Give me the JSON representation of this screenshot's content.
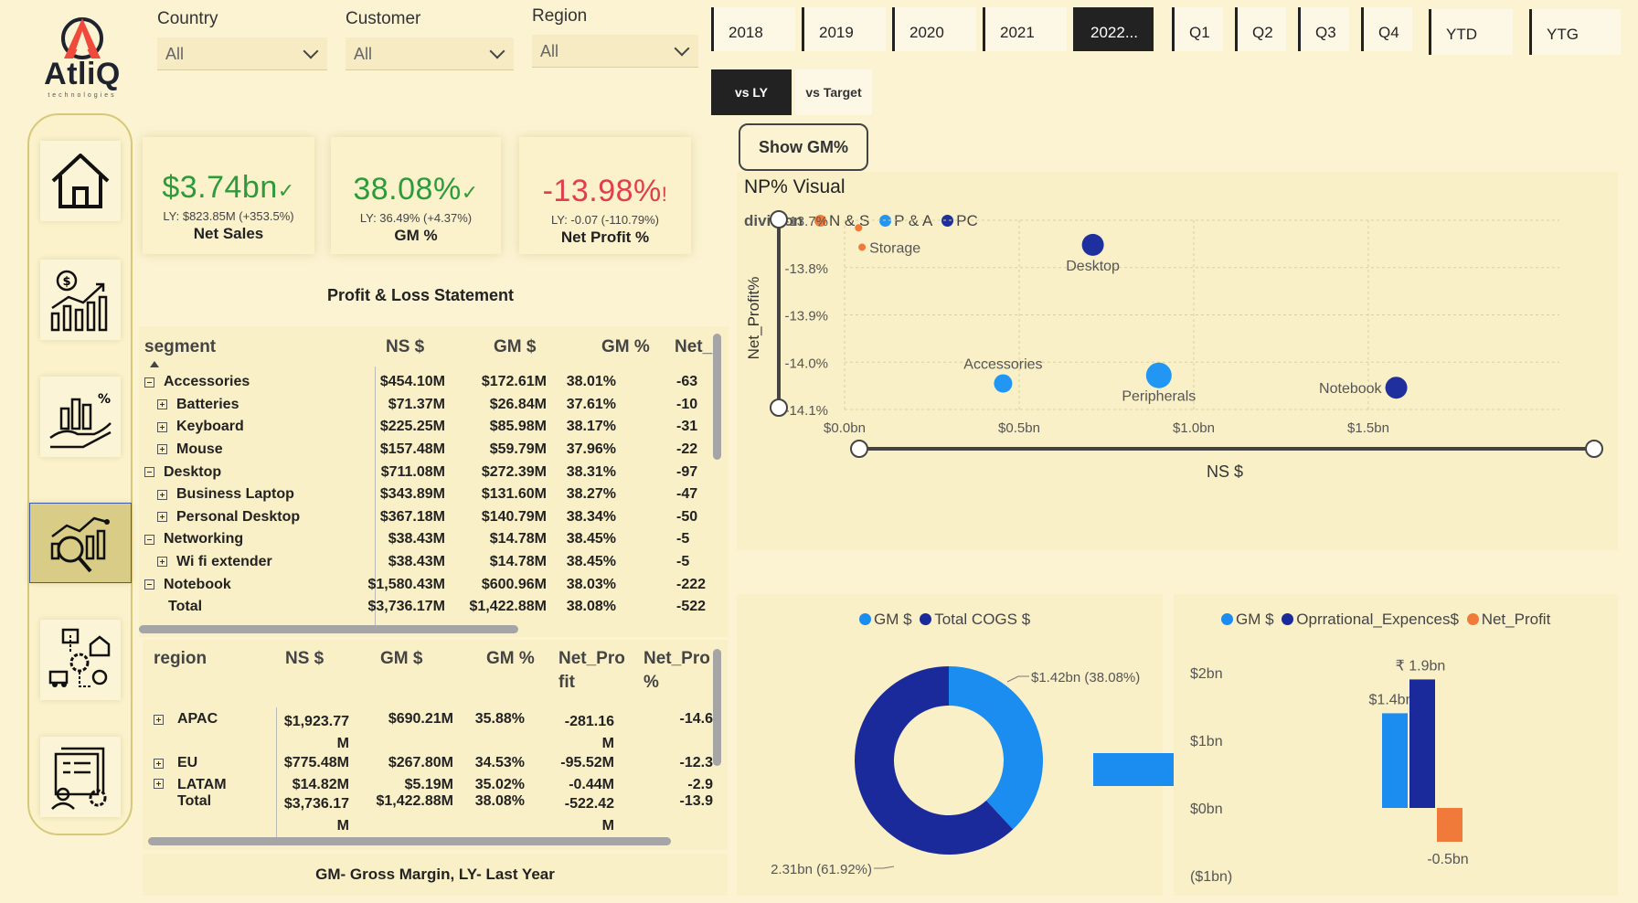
{
  "logo": {
    "name": "AtliQ",
    "sub": "technologies"
  },
  "filters": [
    {
      "label": "Country",
      "value": "All"
    },
    {
      "label": "Customer",
      "value": "All"
    },
    {
      "label": "Region",
      "value": "All"
    }
  ],
  "years": [
    "2018",
    "2019",
    "2020",
    "2021",
    "2022..."
  ],
  "selected_year": "2022...",
  "quarters": [
    "Q1",
    "Q2",
    "Q3",
    "Q4"
  ],
  "periods": [
    "YTD",
    "YTG"
  ],
  "compare": {
    "vs_ly": "vs LY",
    "vs_target": "vs Target",
    "selected": "vs LY"
  },
  "show_gm_button": "Show GM%",
  "nav": [
    "home-icon",
    "finance-chart-icon",
    "analytics-icon",
    "magnifier-chart-icon",
    "supply-chain-icon",
    "executive-report-icon"
  ],
  "kpis": [
    {
      "value": "$3.74bn",
      "mark": "✓",
      "ly": "LY: $823.85M (+353.5%)",
      "label": "Net Sales",
      "color": "#2e9a3c"
    },
    {
      "value": "38.08%",
      "mark": "✓",
      "ly": "LY: 36.49% (+4.37%)",
      "label": "GM %",
      "color": "#2e9a3c"
    },
    {
      "value": "-13.98%",
      "mark": "!",
      "ly": "LY: -0.07 (-110.79%)",
      "label": "Net Profit %",
      "color": "#e0404a"
    }
  ],
  "pl_title": "Profit & Loss Statement",
  "pl_table": {
    "headers": [
      "segment",
      "NS $",
      "GM $",
      "GM %",
      "Net_I"
    ],
    "rows": [
      {
        "level": 0,
        "icon": "minus",
        "name": "Accessories",
        "ns": "$454.10M",
        "gm": "$172.61M",
        "gmp": "38.01%",
        "np": "-63"
      },
      {
        "level": 1,
        "icon": "plus",
        "name": "Batteries",
        "ns": "$71.37M",
        "gm": "$26.84M",
        "gmp": "37.61%",
        "np": "-10"
      },
      {
        "level": 1,
        "icon": "plus",
        "name": "Keyboard",
        "ns": "$225.25M",
        "gm": "$85.98M",
        "gmp": "38.17%",
        "np": "-31"
      },
      {
        "level": 1,
        "icon": "plus",
        "name": "Mouse",
        "ns": "$157.48M",
        "gm": "$59.79M",
        "gmp": "37.96%",
        "np": "-22"
      },
      {
        "level": 0,
        "icon": "minus",
        "name": "Desktop",
        "ns": "$711.08M",
        "gm": "$272.39M",
        "gmp": "38.31%",
        "np": "-97"
      },
      {
        "level": 1,
        "icon": "plus",
        "name": "Business Laptop",
        "ns": "$343.89M",
        "gm": "$131.60M",
        "gmp": "38.27%",
        "np": "-47"
      },
      {
        "level": 1,
        "icon": "plus",
        "name": "Personal Desktop",
        "ns": "$367.18M",
        "gm": "$140.79M",
        "gmp": "38.34%",
        "np": "-50"
      },
      {
        "level": 0,
        "icon": "minus",
        "name": "Networking",
        "ns": "$38.43M",
        "gm": "$14.78M",
        "gmp": "38.45%",
        "np": "-5"
      },
      {
        "level": 1,
        "icon": "plus",
        "name": "Wi fi extender",
        "ns": "$38.43M",
        "gm": "$14.78M",
        "gmp": "38.45%",
        "np": "-5"
      },
      {
        "level": 0,
        "icon": "minus",
        "name": "Notebook",
        "ns": "$1,580.43M",
        "gm": "$600.96M",
        "gmp": "38.03%",
        "np": "-222"
      },
      {
        "level": 0,
        "icon": "none",
        "name": "Total",
        "ns": "$3,736.17M",
        "gm": "$1,422.88M",
        "gmp": "38.08%",
        "np": "-522"
      }
    ]
  },
  "region_table": {
    "headers": [
      "region",
      "NS $",
      "GM $",
      "GM %",
      "Net_Pro fit",
      "Net_Pro %"
    ],
    "rows": [
      {
        "name": "APAC",
        "ns": "$1,923.77 M",
        "gm": "$690.21M",
        "gmp": "35.88%",
        "np": "-281.16 M",
        "npp": "-14.6"
      },
      {
        "name": "EU",
        "ns": "$775.48M",
        "gm": "$267.80M",
        "gmp": "34.53%",
        "np": "-95.52M",
        "npp": "-12.3"
      },
      {
        "name": "LATAM",
        "ns": "$14.82M",
        "gm": "$5.19M",
        "gmp": "35.02%",
        "np": "-0.44M",
        "npp": "-2.9"
      },
      {
        "name": "Total",
        "ns": "$3,736.17 M",
        "gm": "$1,422.88M",
        "gmp": "38.08%",
        "np": "-522.42 M",
        "npp": "-13.9"
      }
    ]
  },
  "footnote": "GM- Gross Margin, LY- Last Year",
  "colors": {
    "ns": "#f07a3a",
    "pa": "#2196f3",
    "pc": "#1f2f9e",
    "cogs": "#1a2a9a",
    "gm": "#1b8cf0",
    "profit": "#f07a3a"
  },
  "chart_data": [
    {
      "type": "scatter",
      "title": "NP% Visual",
      "legend_title": "division",
      "xlabel": "NS $",
      "ylabel": "Net_Profit%",
      "x_ticks": [
        "$0.0bn",
        "$0.5bn",
        "$1.0bn",
        "$1.5bn"
      ],
      "y_ticks": [
        "-13.7%",
        "-13.8%",
        "-13.9%",
        "-14.0%",
        "-14.1%"
      ],
      "xlim": [
        0,
        1.6
      ],
      "ylim": [
        -14.1,
        -13.7
      ],
      "series": [
        {
          "name": "N & S",
          "points": [
            {
              "label": "",
              "x": 0.04,
              "y": -13.716
            },
            {
              "label": "Storage",
              "x": 0.05,
              "y": -13.757
            }
          ]
        },
        {
          "name": "P & A",
          "points": [
            {
              "label": "Accessories",
              "x": 0.454,
              "y": -14.045
            },
            {
              "label": "Peripherals",
              "x": 0.9,
              "y": -14.028
            }
          ]
        },
        {
          "name": "PC",
          "points": [
            {
              "label": "Desktop",
              "x": 0.711,
              "y": -13.752
            },
            {
              "label": "Notebook",
              "x": 1.58,
              "y": -14.054
            }
          ]
        }
      ]
    },
    {
      "type": "pie",
      "legend": [
        "GM $",
        "Total COGS $"
      ],
      "slices": [
        {
          "name": "GM $",
          "value": 1.42,
          "label": "$1.42bn (38.08%)"
        },
        {
          "name": "Total COGS $",
          "value": 2.31,
          "label": "2.31bn (61.92%)"
        }
      ]
    },
    {
      "type": "bar",
      "legend": [
        "GM $",
        "Oprrational_Expences$",
        "Net_Profit"
      ],
      "y_ticks": [
        "$2bn",
        "$1bn",
        "$0bn",
        "($1bn)"
      ],
      "ylim": [
        -1,
        2
      ],
      "series": [
        {
          "name": "GM $",
          "value": 1.4,
          "label": "$1.4bn"
        },
        {
          "name": "Oprrational_Expences$",
          "value": 1.9,
          "label": "₹ 1.9bn"
        },
        {
          "name": "Net_Profit",
          "value": -0.5,
          "label": "-0.5bn"
        }
      ]
    }
  ]
}
